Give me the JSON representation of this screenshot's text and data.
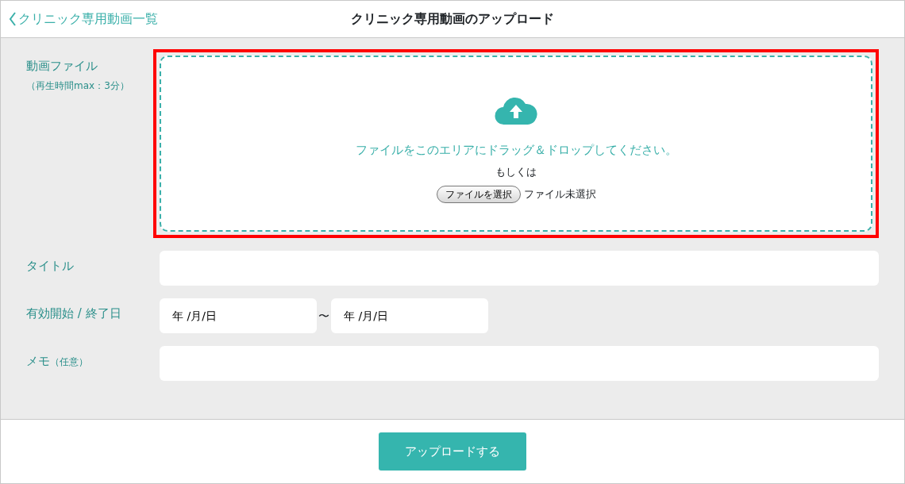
{
  "header": {
    "back_link": "クリニック専用動画一覧",
    "title": "クリニック専用動画のアップロード"
  },
  "video_file": {
    "label": "動画ファイル",
    "note": "（再生時間max：3分）",
    "highlighted": true,
    "drop_text": "ファイルをこのエリアにドラッグ＆ドロップしてください。",
    "or_text": "もしくは",
    "choose_button": "ファイルを選択",
    "file_status": "ファイル未選択"
  },
  "title_field": {
    "label": "タイトル"
  },
  "period": {
    "label": "有効開始 / 終了日",
    "start_placeholder": "年 /月/日",
    "separator": "〜",
    "end_placeholder": "年 /月/日"
  },
  "memo": {
    "label": "メモ",
    "note": "（任意）"
  },
  "submit_button": "アップロードする"
}
